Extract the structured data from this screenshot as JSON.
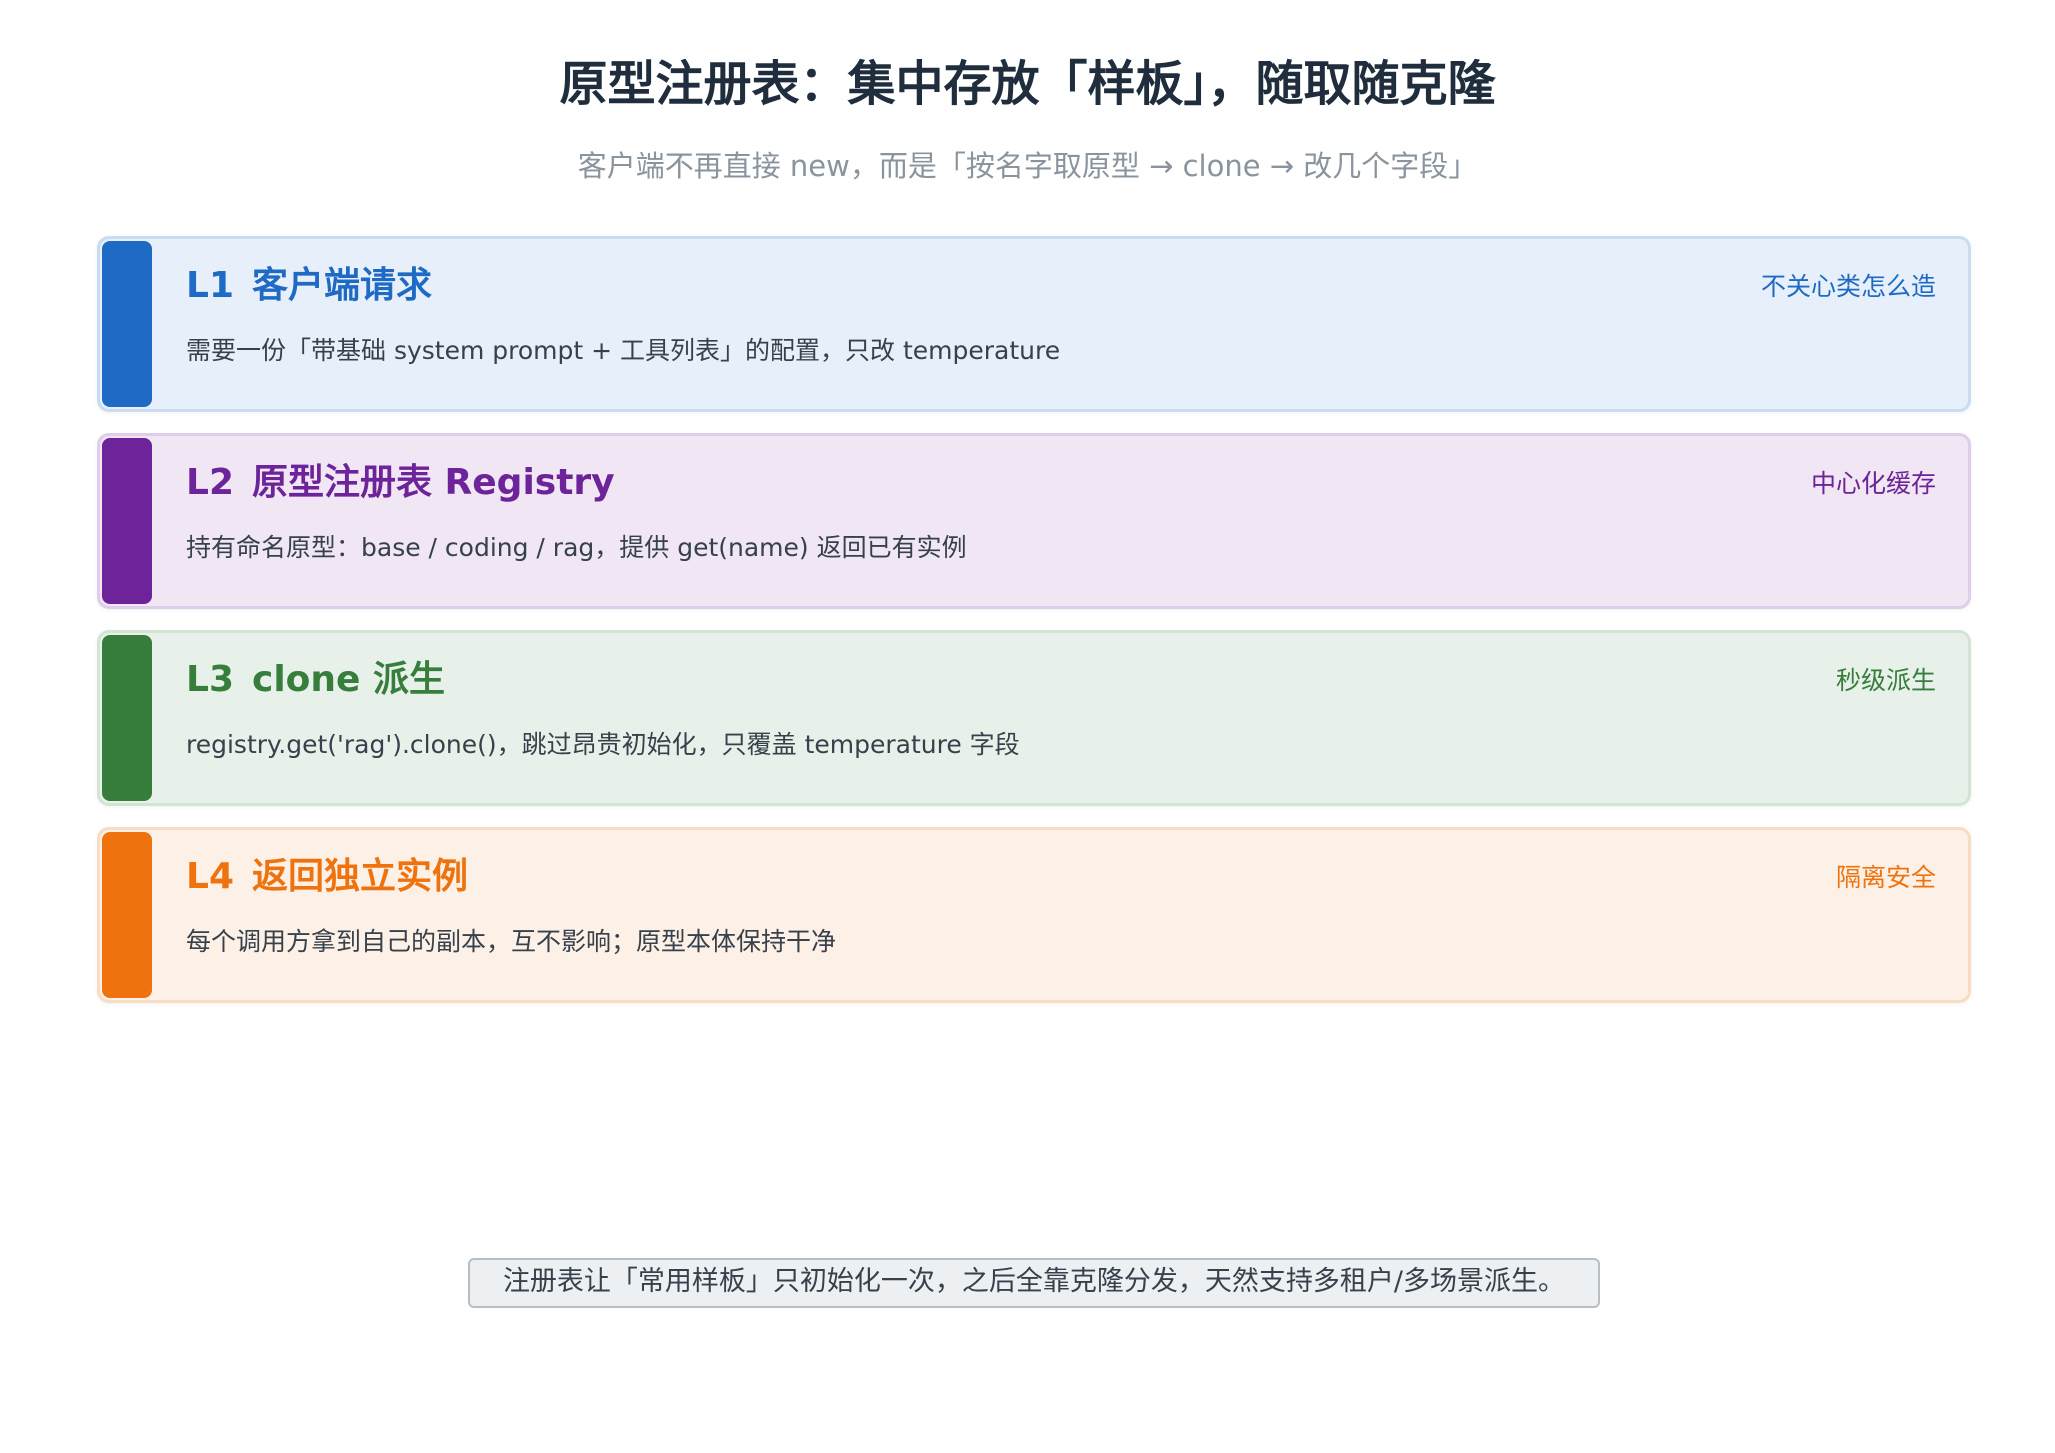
{
  "title": "原型注册表：集中存放「样板」，随取随克隆",
  "subtitle": "客户端不再直接 new，而是「按名字取原型 → clone → 改几个字段」",
  "layers": [
    {
      "code": "L1",
      "name": "客户端请求",
      "tag": "不关心类怎么造",
      "desc": "需要一份「带基础 system prompt + 工具列表」的配置，只改 temperature",
      "accent": "#1e6ac4",
      "bg": "#e7f0fa",
      "border": "#c9dcf3"
    },
    {
      "code": "L2",
      "name": "原型注册表 Registry",
      "tag": "中心化缓存",
      "desc": "持有命名原型：base / coding / rag，提供 get(name) 返回已有实例",
      "accent": "#6d2399",
      "bg": "#f0e6f4",
      "border": "#e0cdea"
    },
    {
      "code": "L3",
      "name": "clone 派生",
      "tag": "秒级派生",
      "desc": "registry.get('rag').clone()，跳过昂贵初始化，只覆盖 temperature 字段",
      "accent": "#377d3c",
      "bg": "#e8f1e9",
      "border": "#d2e5d4"
    },
    {
      "code": "L4",
      "name": "返回独立实例",
      "tag": "隔离安全",
      "desc": "每个调用方拿到自己的副本，互不影响；原型本体保持干净",
      "accent": "#ee730e",
      "bg": "#fdf0e6",
      "border": "#f9dcc4"
    }
  ],
  "footer": "注册表让「常用样板」只初始化一次，之后全靠克隆分发，天然支持多租户/多场景派生。"
}
